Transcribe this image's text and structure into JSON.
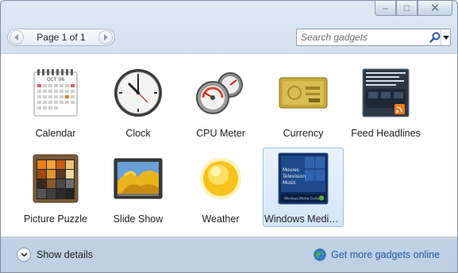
{
  "window": {
    "caption": {
      "minimize": "–",
      "maximize": "□",
      "close": "✕"
    }
  },
  "toolbar": {
    "page_label": "Page 1 of 1",
    "search_placeholder": "Search gadgets"
  },
  "gadgets": [
    {
      "label": "Calendar",
      "icon": "calendar-icon"
    },
    {
      "label": "Clock",
      "icon": "clock-icon"
    },
    {
      "label": "CPU Meter",
      "icon": "cpu-meter-icon"
    },
    {
      "label": "Currency",
      "icon": "currency-icon"
    },
    {
      "label": "Feed Headlines",
      "icon": "feed-headlines-icon"
    },
    {
      "label": "Picture Puzzle",
      "icon": "picture-puzzle-icon"
    },
    {
      "label": "Slide Show",
      "icon": "slide-show-icon"
    },
    {
      "label": "Weather",
      "icon": "weather-icon"
    },
    {
      "label": "Windows Media...",
      "icon": "windows-media-center-icon",
      "selected": true
    }
  ],
  "thumb_text": {
    "calendar_month": "OCT 06",
    "wmc_items": [
      "Movies",
      "Television",
      "Music"
    ],
    "wmc_bar": "Windows Media Center"
  },
  "footer": {
    "show_details": "Show details",
    "get_more": "Get more gadgets online"
  },
  "colors": {
    "link": "#1b5aa8",
    "selection": "#d3e6fb",
    "accent_orange": "#f27a1a"
  }
}
